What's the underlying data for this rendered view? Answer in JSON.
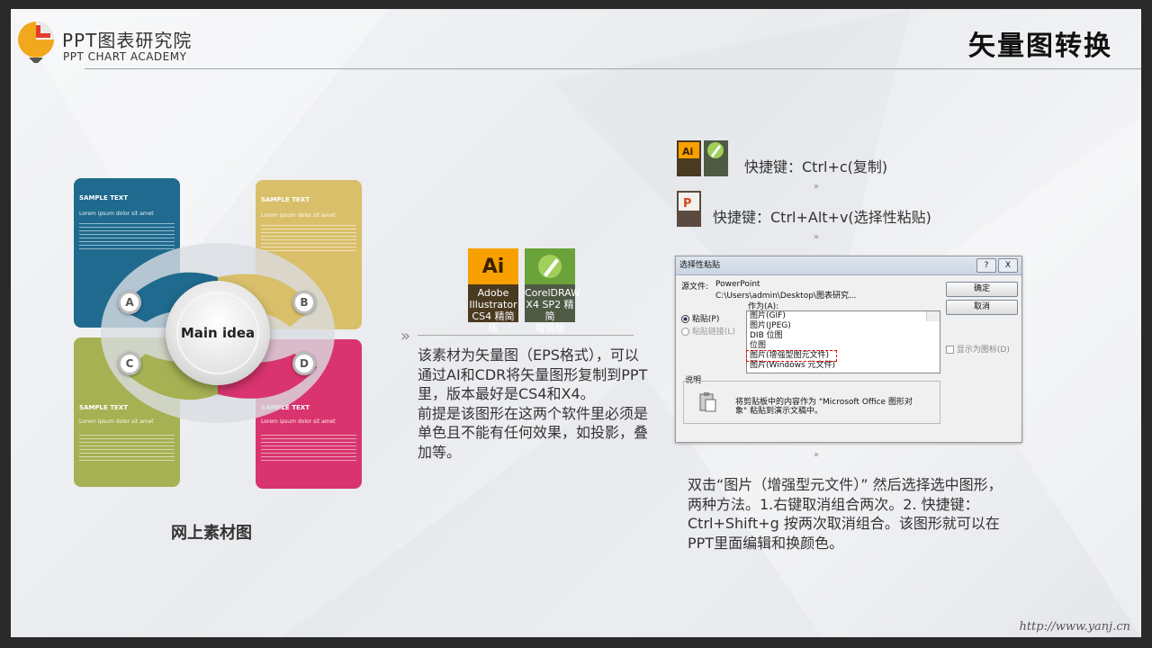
{
  "header": {
    "brand_cn": "PPT图表研究院",
    "brand_en": "PPT CHART ACADEMY",
    "title": "矢量图转换"
  },
  "infographic": {
    "cards": [
      {
        "id": "A",
        "color": "#1f6a8e",
        "heading": "SAMPLE TEXT",
        "subheading": "Lorem ipsum dolor sit amet"
      },
      {
        "id": "B",
        "color": "#d9bf6a",
        "heading": "SAMPLE TEXT",
        "subheading": "Lorem ipsum dolor sit amet"
      },
      {
        "id": "C",
        "color": "#a5b153",
        "heading": "SAMPLE TEXT",
        "subheading": "Lorem ipsum dolor sit amet"
      },
      {
        "id": "D",
        "color": "#d9346e",
        "heading": "SAMPLE TEXT",
        "subheading": "Lorem ipsum dolor sit amet"
      }
    ],
    "center_label": "Main idea",
    "caption": "网上素材图"
  },
  "software": {
    "illustrator": {
      "icon_text": "Ai",
      "label_1": "Adobe",
      "label_2": "Illustrator",
      "label_3": "CS4 精简版"
    },
    "coreldraw": {
      "label_1": "CorelDRAW",
      "label_2": "X4 SP2 精简",
      "label_3": "增强版"
    }
  },
  "description": {
    "p1": "该素材为矢量图（EPS格式），可以通过AI和CDR将矢量图形复制到PPT里，版本最好是CS4和X4。",
    "p2": "前提是该图形在这两个软件里必须是单色且不能有任何效果，如投影，叠加等。"
  },
  "shortcuts": {
    "copy": "快捷键：Ctrl+c(复制)",
    "paste": "快捷键：Ctrl+Alt+v(选择性粘贴)",
    "arrow": "»"
  },
  "dialog": {
    "title": "选择性粘贴",
    "help": "?",
    "close": "X",
    "source_label": "源文件:",
    "source_line1": "PowerPoint",
    "source_line2": "C:\\Users\\admin\\Desktop\\图表研究...",
    "as_label": "作为(A):",
    "paste_option": "粘贴(P)",
    "paste_link_option": "粘贴链接(L)",
    "list_items": [
      "图片(GIF)",
      "图片(JPEG)",
      "DIB 位图",
      "位图",
      "图片(增强型图元文件)",
      "图片(Windows 元文件)"
    ],
    "ok": "确定",
    "cancel": "取消",
    "show_icon": "显示为图标(D)",
    "explain_label": "说明",
    "explain_text_1": "将剪贴板中的内容作为 \"Microsoft Office 图形对",
    "explain_text_2": "象\" 粘贴到演示文稿中。"
  },
  "instructions": "双击“图片（增强型元文件）” 然后选择选中图形，两种方法。1.右键取消组合两次。2. 快捷键：Ctrl+Shift+g 按两次取消组合。该图形就可以在PPT里面编辑和换颜色。",
  "footer_url": "http://www.yanj.cn"
}
